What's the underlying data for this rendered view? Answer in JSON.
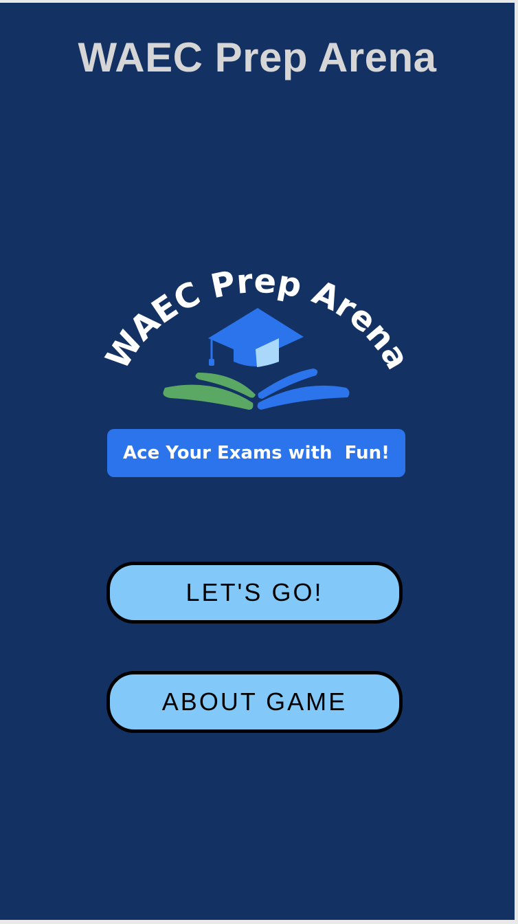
{
  "header": {
    "title": "WAEC Prep Arena"
  },
  "logo": {
    "arc_text": "WAEC Prep Arena",
    "tagline": "Ace Your Exams with  Fun!"
  },
  "buttons": {
    "lets_go_label": "LET'S GO!",
    "about_label": "ABOUT GAME"
  },
  "colors": {
    "background": "#133263",
    "title": "#d6d6d6",
    "button_fill": "#82c8f8",
    "accent_blue": "#2b74ec",
    "leaf_green": "#5aa863"
  },
  "icons": [
    "graduation-cap-icon",
    "open-book-icon"
  ]
}
